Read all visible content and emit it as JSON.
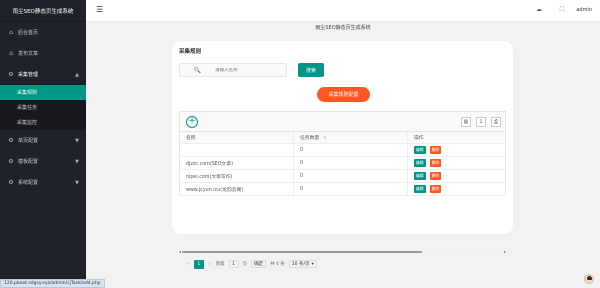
{
  "app": {
    "title": "雨尘SEO静态页生成系统"
  },
  "sidebar": {
    "items": [
      {
        "label": "后台首页",
        "icon": "home-icon",
        "glyph": "⌂"
      },
      {
        "label": "发布文章",
        "icon": "home-icon",
        "glyph": "⌂"
      },
      {
        "label": "采集管理",
        "icon": "gear-icon",
        "glyph": "⚙",
        "arrow": "▲"
      },
      {
        "label": "单页配置",
        "icon": "gear-icon",
        "glyph": "⚙",
        "arrow": "▼"
      },
      {
        "label": "模板配置",
        "icon": "gear-icon",
        "glyph": "⚙",
        "arrow": "▼"
      },
      {
        "label": "系统配置",
        "icon": "gear-icon",
        "glyph": "⚙",
        "arrow": "▼"
      }
    ],
    "sub_items": [
      {
        "label": "采集规则",
        "active": true
      },
      {
        "label": "采集任务",
        "active": false
      },
      {
        "label": "采集监控",
        "active": false
      }
    ]
  },
  "header": {
    "menu_glyph": "☰",
    "theme_glyph": "☁",
    "fullscreen_glyph": "⛶",
    "user": "admin"
  },
  "page": {
    "title": "雨尘SEO静态页生成系统"
  },
  "card": {
    "title": "采集规则",
    "search": {
      "placeholder": "请输入名称",
      "button": "搜索",
      "glyph": "🔍"
    },
    "config_button": "采集规则配置",
    "toolbar": {
      "add_glyph": "+",
      "filter_glyph": "▥",
      "export_glyph": "⇩",
      "print_glyph": "⎙"
    },
    "table": {
      "headers": [
        "名称",
        "任务数量",
        "操作"
      ],
      "sort_glyph": "⇕",
      "rows": [
        {
          "name": "",
          "count": "0",
          "edit": "编辑",
          "del": "删除"
        },
        {
          "name": "djzzc.com(SEO文章)",
          "count": "0",
          "edit": "编辑",
          "del": "删除"
        },
        {
          "name": "nipei.com(文章写作)",
          "count": "0",
          "edit": "编辑",
          "del": "删除"
        },
        {
          "name": "www.jcyun.icu(龙韵云阁)",
          "count": "0",
          "edit": "编辑",
          "del": "删除"
        }
      ]
    },
    "pager": {
      "prev": "<",
      "current": "1",
      "next": ">",
      "goto_label": "到第",
      "goto_value": "1",
      "page_unit": "页",
      "confirm": "确定",
      "total": "共 4 条",
      "page_size": "10 条/页",
      "size_arrow": "▾"
    }
  },
  "status_bar": {
    "url": "120.pboot.sdgsy.xyz/admin/cjTask/add.php"
  },
  "colors": {
    "accent": "#009688",
    "danger": "#ff5722",
    "sidebar_bg": "#20222a"
  }
}
